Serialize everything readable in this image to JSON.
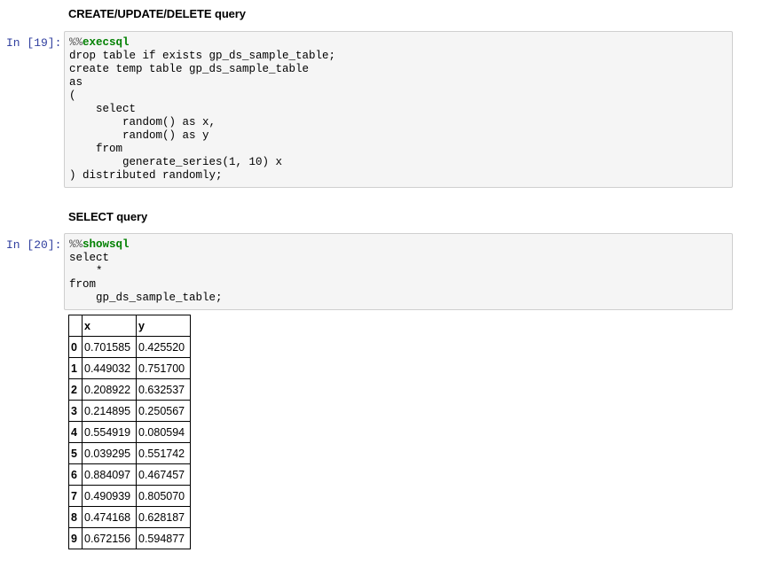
{
  "cells": [
    {
      "heading": "CREATE/UPDATE/DELETE query",
      "prompt": "In [19]:",
      "magic_prefix": "%%",
      "magic_name": "execsql",
      "code_lines": [
        "drop table if exists gp_ds_sample_table;",
        "create temp table gp_ds_sample_table",
        "as",
        "(",
        "    select",
        "        random() as x,",
        "        random() as y",
        "    from",
        "        generate_series(1, 10) x",
        ") distributed randomly;"
      ]
    },
    {
      "heading": "SELECT query",
      "prompt": "In [20]:",
      "magic_prefix": "%%",
      "magic_name": "showsql",
      "code_lines": [
        "select",
        "    *",
        "from",
        "    gp_ds_sample_table;"
      ]
    }
  ],
  "output_table": {
    "columns": [
      "",
      "x",
      "y"
    ],
    "rows": [
      {
        "index": "0",
        "x": "0.701585",
        "y": "0.425520"
      },
      {
        "index": "1",
        "x": "0.449032",
        "y": "0.751700"
      },
      {
        "index": "2",
        "x": "0.208922",
        "y": "0.632537"
      },
      {
        "index": "3",
        "x": "0.214895",
        "y": "0.250567"
      },
      {
        "index": "4",
        "x": "0.554919",
        "y": "0.080594"
      },
      {
        "index": "5",
        "x": "0.039295",
        "y": "0.551742"
      },
      {
        "index": "6",
        "x": "0.884097",
        "y": "0.467457"
      },
      {
        "index": "7",
        "x": "0.490939",
        "y": "0.805070"
      },
      {
        "index": "8",
        "x": "0.474168",
        "y": "0.628187"
      },
      {
        "index": "9",
        "x": "0.672156",
        "y": "0.594877"
      }
    ]
  }
}
